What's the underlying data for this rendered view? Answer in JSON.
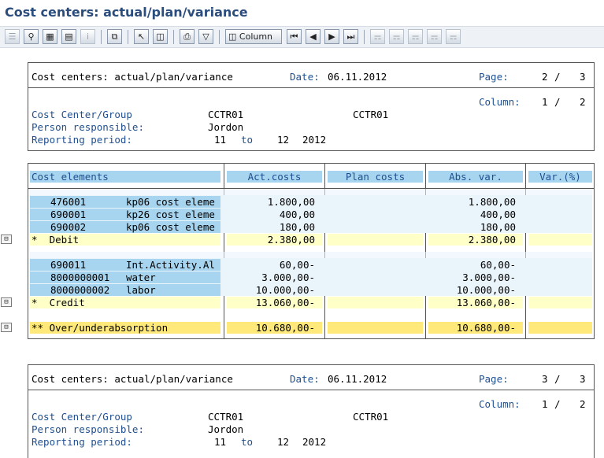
{
  "window_title": "Cost centers: actual/plan/variance",
  "toolbar": {
    "column_button": "Column",
    "icons": [
      "tree-icon",
      "find-icon",
      "layout-icon",
      "sheet-icon",
      "info-icon",
      "export-icon",
      "pointer-icon",
      "table-icon",
      "print-icon",
      "filter-icon",
      "column-icon",
      "first-page-icon",
      "prev-page-icon",
      "next-page-icon",
      "last-page-icon",
      "hier1-icon",
      "hier2-icon",
      "hier3-icon",
      "hier4-icon",
      "hier5-icon"
    ]
  },
  "pages": [
    {
      "title": "Cost centers: actual/plan/variance",
      "date_label": "Date:",
      "date": "06.11.2012",
      "page_label": "Page:",
      "page_current": "2",
      "page_slash": "/",
      "page_total": "3",
      "column_label": "Column:",
      "column_current": "1",
      "column_slash": "/",
      "column_total": "2",
      "cc_label": "Cost Center/Group",
      "cc_value1": "CCTR01",
      "cc_value2": "CCTR01",
      "person_label": "Person responsible:",
      "person_value": "Jordon",
      "period_label": "Reporting period:",
      "period_from": "11",
      "period_to_label": "to",
      "period_to": "12",
      "period_year": "2012"
    },
    {
      "title": "Cost centers: actual/plan/variance",
      "date_label": "Date:",
      "date": "06.11.2012",
      "page_label": "Page:",
      "page_current": "3",
      "page_slash": "/",
      "page_total": "3",
      "column_label": "Column:",
      "column_current": "1",
      "column_slash": "/",
      "column_total": "2",
      "cc_label": "Cost Center/Group",
      "cc_value1": "CCTR01",
      "cc_value2": "CCTR01",
      "person_label": "Person responsible:",
      "person_value": "Jordon",
      "period_label": "Reporting period:",
      "period_from": "11",
      "period_to_label": "to",
      "period_to": "12",
      "period_year": "2012"
    }
  ],
  "table": {
    "headers": [
      "Cost elements",
      "Act.costs",
      "Plan costs",
      "Abs. var.",
      "Var.(%)"
    ],
    "debit_rows": [
      {
        "code": "476001",
        "desc": "kp06 cost eleme",
        "act": "1.800,00",
        "plan": "",
        "abs": "1.800,00",
        "pct": ""
      },
      {
        "code": "690001",
        "desc": "kp26 cost eleme",
        "act": "400,00",
        "plan": "",
        "abs": "400,00",
        "pct": ""
      },
      {
        "code": "690002",
        "desc": "kp06 cost eleme",
        "act": "180,00",
        "plan": "",
        "abs": "180,00",
        "pct": ""
      }
    ],
    "debit_total": {
      "label": "*  Debit",
      "act": "2.380,00",
      "abs": "2.380,00"
    },
    "credit_rows": [
      {
        "code": "690011",
        "desc": "Int.Activity.Al",
        "act": "60,00-",
        "plan": "",
        "abs": "60,00-",
        "pct": ""
      },
      {
        "code": "8000000001",
        "desc": "water",
        "act": "3.000,00-",
        "plan": "",
        "abs": "3.000,00-",
        "pct": ""
      },
      {
        "code": "8000000002",
        "desc": "labor",
        "act": "10.000,00-",
        "plan": "",
        "abs": "10.000,00-",
        "pct": ""
      }
    ],
    "credit_total": {
      "label": "*  Credit",
      "act": "13.060,00-",
      "abs": "13.060,00-"
    },
    "grand_total": {
      "label": "** Over/underabsorption",
      "act": "10.680,00-",
      "abs": "10.680,00-"
    }
  },
  "colors": {
    "title_blue": "#2b4d7d",
    "header_fill": "#a7d4ef",
    "subtotal_fill": "#ffffc8",
    "total_fill": "#ffe97a",
    "text_blue": "#1f4f8f"
  }
}
